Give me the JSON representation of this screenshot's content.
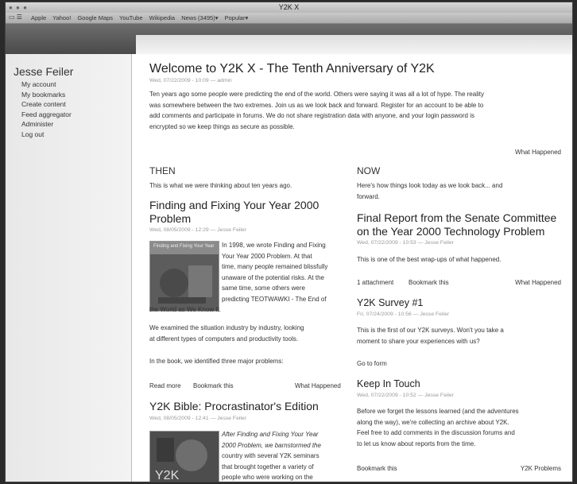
{
  "window": {
    "title": "Y2K X"
  },
  "bookmarks": [
    "Apple",
    "Yahoo!",
    "Google Maps",
    "YouTube",
    "Wikipedia",
    "News (3495)▾",
    "Popular▾"
  ],
  "sidebar": {
    "user": "Jesse Feiler",
    "items": [
      "My account",
      "My bookmarks",
      "Create content",
      "Feed aggregator",
      "Administer",
      "Log out"
    ]
  },
  "intro": {
    "title": "Welcome to Y2K X - The Tenth Anniversary of Y2K",
    "meta": "Wed, 07/22/2009 - 10:09 — admin",
    "lines": [
      "Ten years ago some people were predicting the end of the world. Others were saying it was all a lot of hype. The reality",
      "was somewhere between the two extremes. Join us as we look back and forward. Register for an account to be able to",
      "add comments and participate in forums. We do not share registration data with anyone, and your login password is",
      "encrypted so we keep things as secure as possible."
    ],
    "link": "What Happened"
  },
  "then": {
    "heading": "THEN",
    "desc": "This is what we were thinking about ten years ago.",
    "post1": {
      "title_lines": [
        "Finding and Fixing Your Year 2000",
        "Problem"
      ],
      "meta": "Wed, 08/05/2009 - 12:29 — Jesse Feiler",
      "thumb_text": "Finding and Fixing Your Year",
      "body_lines": [
        "In 1998, we wrote Finding and Fixing",
        "Your Year 2000 Problem. At that",
        "time, many people remained blissfully",
        "unaware of the potential risks. At the",
        "same time, some others were",
        "predicting TEOTWAWKI - The End of"
      ],
      "body_full": "the World as We Know It.",
      "para2": [
        "We examined the situation industry by industry, looking",
        "at different types of computers and productivity tools."
      ],
      "para3": "In the book, we identified three major problems:",
      "links": {
        "read_more": "Read more",
        "bookmark": "Bookmark this",
        "category": "What Happened"
      }
    },
    "post2": {
      "title": "Y2K Bible: Procrastinator's Edition",
      "meta": "Wed, 08/05/2009 - 12:41 — Jesse Feiler",
      "thumb_text": "Y2K",
      "body_lines": [
        "After Finding and Fixing Your Year",
        "2000 Problem, we barnstormed the",
        "country with several Y2K seminars",
        "that brought together a variety of",
        "people who were working on the"
      ]
    }
  },
  "now": {
    "heading": "NOW",
    "desc": [
      "Here's how things look today as we look back... and",
      "forward."
    ],
    "post1": {
      "title_lines": [
        "Final Report from the Senate Committee",
        "on the Year 2000 Technology Problem"
      ],
      "meta": "Wed, 07/22/2009 - 10:53 — Jesse Feiler",
      "body": "This is one of the best wrap-ups of what happened.",
      "links": {
        "attachment": "1 attachment",
        "bookmark": "Bookmark this",
        "category": "What Happened"
      }
    },
    "post2": {
      "title": "Y2K Survey #1",
      "meta": "Fri, 07/24/2009 - 10:56 — Jesse Feiler",
      "body": [
        "This is the first of our Y2K surveys. Won't you take a",
        "moment to share your experiences with us?"
      ],
      "link": "Go to form"
    },
    "post3": {
      "title": "Keep In Touch",
      "meta": "Wed, 07/22/2009 - 10:52 — Jesse Feiler",
      "body": [
        "Before we forget the lessons learned (and the adventures",
        "along the way), we're collecting an archive about Y2K.",
        "Feel free to add comments in the discussion forums and",
        "to let us know about reports from the time."
      ],
      "links": {
        "bookmark": "Bookmark this",
        "category": "Y2K Problems"
      }
    }
  }
}
